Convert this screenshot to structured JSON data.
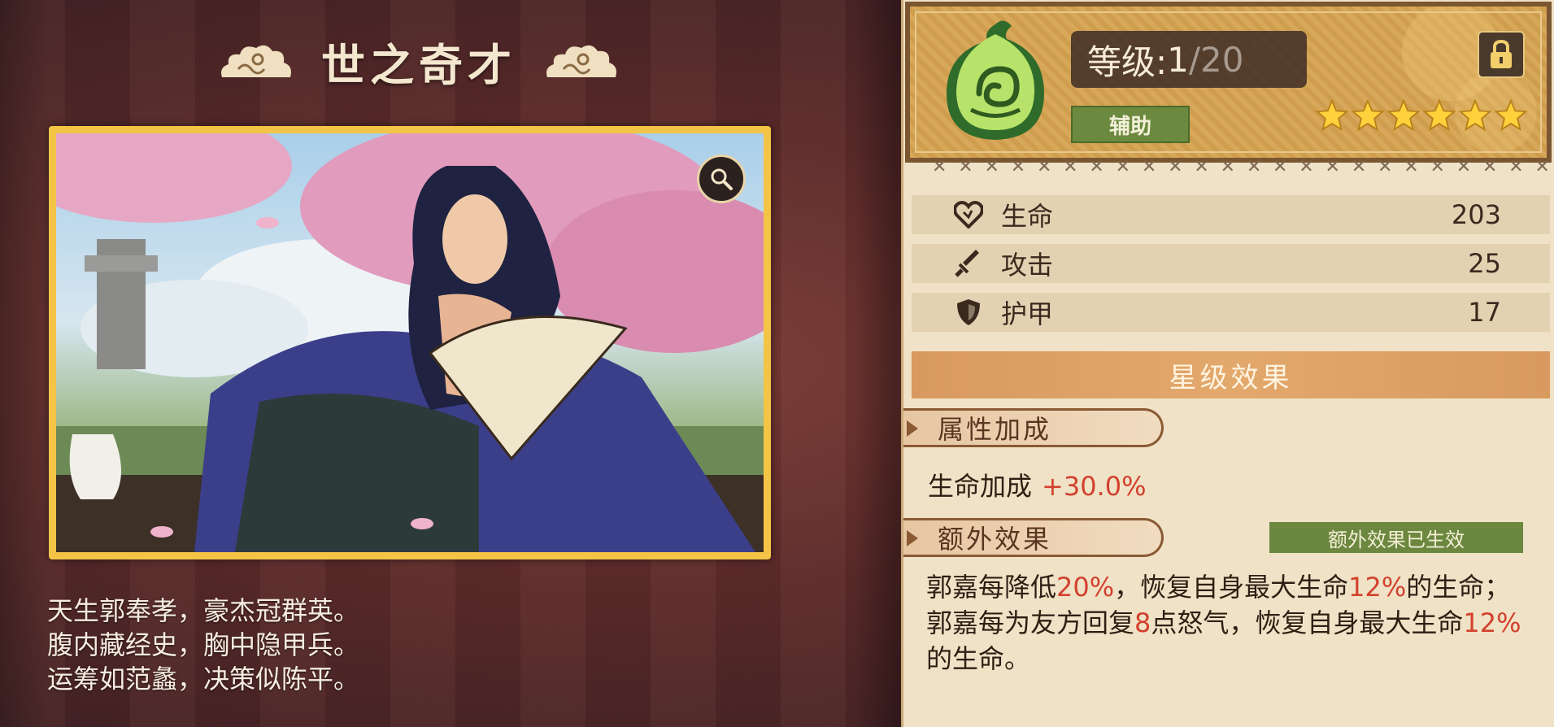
{
  "hero": {
    "title": "世之奇才",
    "poem": [
      "天生郭奉孝，豪杰冠群英。",
      "腹内藏经史，胸中隐甲兵。",
      "运筹如范蠡，决策似陈平。"
    ]
  },
  "header": {
    "level_label": "等级:",
    "level_current": "1",
    "level_max": "/20",
    "role": "辅助",
    "stars": 6
  },
  "stats": [
    {
      "icon": "heart-icon",
      "label": "生命",
      "value": "203"
    },
    {
      "icon": "sword-icon",
      "label": "攻击",
      "value": "25"
    },
    {
      "icon": "shield-icon",
      "label": "护甲",
      "value": "17"
    }
  ],
  "star_effect": {
    "title": "星级效果",
    "attr_section": "属性加成",
    "attr_bonus_label": "生命加成",
    "attr_bonus_value": "+30.0%",
    "extra_section": "额外效果",
    "extra_status": "额外效果已生效",
    "desc1_a": "郭嘉每降低",
    "desc1_b": "20%",
    "desc1_c": "，恢复自身最大生命",
    "desc1_d": "12%",
    "desc1_e": "的生命；",
    "desc2_a": "郭嘉每为友方回复",
    "desc2_b": "8",
    "desc2_c": "点怒气，恢复自身最大生命",
    "desc2_d": "12%",
    "desc2_e": "的生命。"
  },
  "colors": {
    "accent_red": "#d2412e",
    "badge_green": "#6b8a3f",
    "frame_gold": "#f4c447"
  }
}
